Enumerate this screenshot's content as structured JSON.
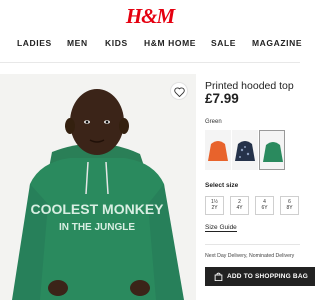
{
  "brand": {
    "logo": "H&M"
  },
  "nav": {
    "items": [
      "LADIES",
      "MEN",
      "KIDS",
      "H&M HOME",
      "SALE",
      "MAGAZINE"
    ]
  },
  "product": {
    "title": "Printed hooded top",
    "price": "£7.99",
    "image_print_line1": "COOLEST MONKEY",
    "image_print_line2": "IN THE JUNGLE",
    "color_label": "Green",
    "swatches": [
      {
        "name": "orange",
        "color": "#e8632c"
      },
      {
        "name": "navy",
        "color": "#25324a"
      },
      {
        "name": "green",
        "color": "#2a8a5e",
        "selected": true
      }
    ],
    "size_label": "Select size",
    "sizes": [
      {
        "range": "1½",
        "unit": "2Y"
      },
      {
        "range": "2",
        "unit": "4Y"
      },
      {
        "range": "4",
        "unit": "6Y"
      },
      {
        "range": "6",
        "unit": "8Y"
      }
    ],
    "size_guide": "Size Guide",
    "delivery": "Next Day Delivery, Nominated Delivery",
    "cart_label": "ADD TO SHOPPING BAG"
  },
  "colors": {
    "brand_red": "#e50010",
    "hoodie_green": "#2a8a5e",
    "button_dark": "#222222"
  }
}
